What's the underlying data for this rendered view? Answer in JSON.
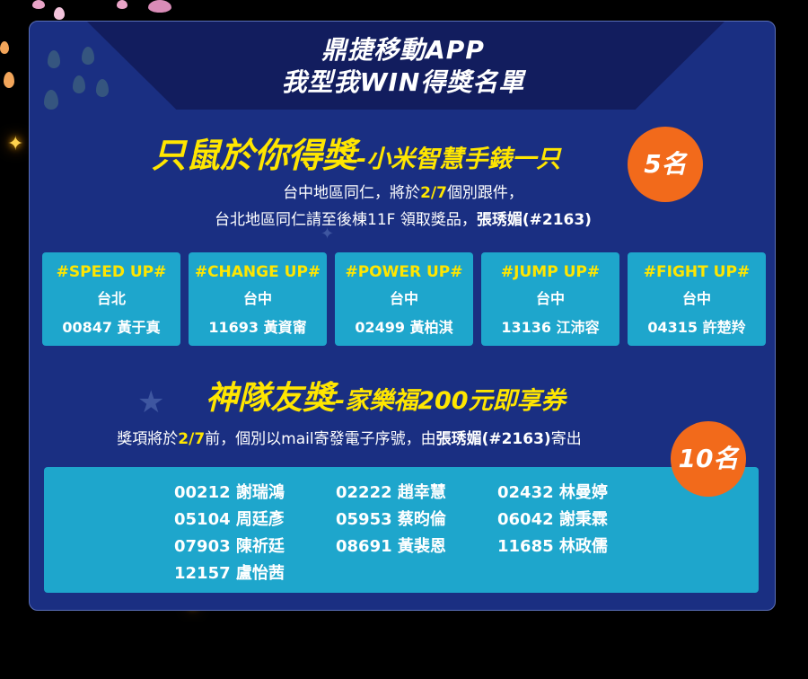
{
  "header": {
    "title_line1": "鼎捷移動APP",
    "title_line2": "我型我WIN得獎名單"
  },
  "prize1": {
    "heading_main": "只鼠於你得獎",
    "heading_sub": "-小米智慧手錶一只",
    "badge": "5名",
    "note_line1_a": "台中地區同仁，將於",
    "note_line1_date": "2/7",
    "note_line1_b": "個別跟件，",
    "note_line2_a": "台北地區同仁請至後棟11F 領取獎品，",
    "note_line2_contact": "張琇媚(#2163)",
    "teams": [
      {
        "name": "#SPEED UP#",
        "city": "台北",
        "winner": "00847  黃于真"
      },
      {
        "name": "#CHANGE UP#",
        "city": "台中",
        "winner": "11693  黃資甯"
      },
      {
        "name": "#POWER UP#",
        "city": "台中",
        "winner": "02499  黃柏淇"
      },
      {
        "name": "#JUMP UP#",
        "city": "台中",
        "winner": "13136  江沛容"
      },
      {
        "name": "#FIGHT UP#",
        "city": "台中",
        "winner": "04315  許楚羚"
      }
    ]
  },
  "prize2": {
    "heading_main": "神隊友獎",
    "heading_sub": "-家樂福200元即享券",
    "badge": "10名",
    "note_a": "獎項將於",
    "note_date": "2/7",
    "note_b": "前，個別以mail寄發電子序號，由",
    "note_contact": "張琇媚(#2163)",
    "note_c": "寄出",
    "winners": [
      "00212  謝瑞鴻",
      "02222  趙幸慧",
      "02432  林曼婷",
      "05104  周廷彥",
      "05953  蔡昀倫",
      "06042  謝秉霖",
      "07903  陳祈廷",
      "08691  黃裴恩",
      "11685  林政儒",
      "12157  盧怡茜"
    ]
  }
}
